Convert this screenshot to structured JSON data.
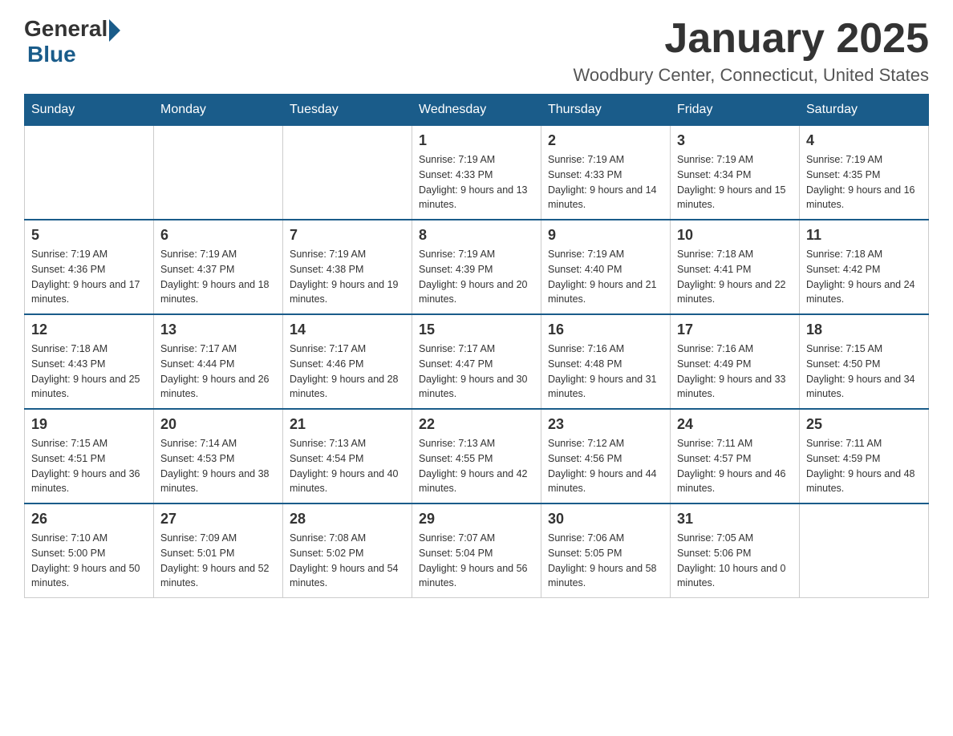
{
  "header": {
    "logo_general": "General",
    "logo_blue": "Blue",
    "title": "January 2025",
    "subtitle": "Woodbury Center, Connecticut, United States"
  },
  "days_of_week": [
    "Sunday",
    "Monday",
    "Tuesday",
    "Wednesday",
    "Thursday",
    "Friday",
    "Saturday"
  ],
  "weeks": [
    [
      {
        "day": "",
        "info": ""
      },
      {
        "day": "",
        "info": ""
      },
      {
        "day": "",
        "info": ""
      },
      {
        "day": "1",
        "info": "Sunrise: 7:19 AM\nSunset: 4:33 PM\nDaylight: 9 hours and 13 minutes."
      },
      {
        "day": "2",
        "info": "Sunrise: 7:19 AM\nSunset: 4:33 PM\nDaylight: 9 hours and 14 minutes."
      },
      {
        "day": "3",
        "info": "Sunrise: 7:19 AM\nSunset: 4:34 PM\nDaylight: 9 hours and 15 minutes."
      },
      {
        "day": "4",
        "info": "Sunrise: 7:19 AM\nSunset: 4:35 PM\nDaylight: 9 hours and 16 minutes."
      }
    ],
    [
      {
        "day": "5",
        "info": "Sunrise: 7:19 AM\nSunset: 4:36 PM\nDaylight: 9 hours and 17 minutes."
      },
      {
        "day": "6",
        "info": "Sunrise: 7:19 AM\nSunset: 4:37 PM\nDaylight: 9 hours and 18 minutes."
      },
      {
        "day": "7",
        "info": "Sunrise: 7:19 AM\nSunset: 4:38 PM\nDaylight: 9 hours and 19 minutes."
      },
      {
        "day": "8",
        "info": "Sunrise: 7:19 AM\nSunset: 4:39 PM\nDaylight: 9 hours and 20 minutes."
      },
      {
        "day": "9",
        "info": "Sunrise: 7:19 AM\nSunset: 4:40 PM\nDaylight: 9 hours and 21 minutes."
      },
      {
        "day": "10",
        "info": "Sunrise: 7:18 AM\nSunset: 4:41 PM\nDaylight: 9 hours and 22 minutes."
      },
      {
        "day": "11",
        "info": "Sunrise: 7:18 AM\nSunset: 4:42 PM\nDaylight: 9 hours and 24 minutes."
      }
    ],
    [
      {
        "day": "12",
        "info": "Sunrise: 7:18 AM\nSunset: 4:43 PM\nDaylight: 9 hours and 25 minutes."
      },
      {
        "day": "13",
        "info": "Sunrise: 7:17 AM\nSunset: 4:44 PM\nDaylight: 9 hours and 26 minutes."
      },
      {
        "day": "14",
        "info": "Sunrise: 7:17 AM\nSunset: 4:46 PM\nDaylight: 9 hours and 28 minutes."
      },
      {
        "day": "15",
        "info": "Sunrise: 7:17 AM\nSunset: 4:47 PM\nDaylight: 9 hours and 30 minutes."
      },
      {
        "day": "16",
        "info": "Sunrise: 7:16 AM\nSunset: 4:48 PM\nDaylight: 9 hours and 31 minutes."
      },
      {
        "day": "17",
        "info": "Sunrise: 7:16 AM\nSunset: 4:49 PM\nDaylight: 9 hours and 33 minutes."
      },
      {
        "day": "18",
        "info": "Sunrise: 7:15 AM\nSunset: 4:50 PM\nDaylight: 9 hours and 34 minutes."
      }
    ],
    [
      {
        "day": "19",
        "info": "Sunrise: 7:15 AM\nSunset: 4:51 PM\nDaylight: 9 hours and 36 minutes."
      },
      {
        "day": "20",
        "info": "Sunrise: 7:14 AM\nSunset: 4:53 PM\nDaylight: 9 hours and 38 minutes."
      },
      {
        "day": "21",
        "info": "Sunrise: 7:13 AM\nSunset: 4:54 PM\nDaylight: 9 hours and 40 minutes."
      },
      {
        "day": "22",
        "info": "Sunrise: 7:13 AM\nSunset: 4:55 PM\nDaylight: 9 hours and 42 minutes."
      },
      {
        "day": "23",
        "info": "Sunrise: 7:12 AM\nSunset: 4:56 PM\nDaylight: 9 hours and 44 minutes."
      },
      {
        "day": "24",
        "info": "Sunrise: 7:11 AM\nSunset: 4:57 PM\nDaylight: 9 hours and 46 minutes."
      },
      {
        "day": "25",
        "info": "Sunrise: 7:11 AM\nSunset: 4:59 PM\nDaylight: 9 hours and 48 minutes."
      }
    ],
    [
      {
        "day": "26",
        "info": "Sunrise: 7:10 AM\nSunset: 5:00 PM\nDaylight: 9 hours and 50 minutes."
      },
      {
        "day": "27",
        "info": "Sunrise: 7:09 AM\nSunset: 5:01 PM\nDaylight: 9 hours and 52 minutes."
      },
      {
        "day": "28",
        "info": "Sunrise: 7:08 AM\nSunset: 5:02 PM\nDaylight: 9 hours and 54 minutes."
      },
      {
        "day": "29",
        "info": "Sunrise: 7:07 AM\nSunset: 5:04 PM\nDaylight: 9 hours and 56 minutes."
      },
      {
        "day": "30",
        "info": "Sunrise: 7:06 AM\nSunset: 5:05 PM\nDaylight: 9 hours and 58 minutes."
      },
      {
        "day": "31",
        "info": "Sunrise: 7:05 AM\nSunset: 5:06 PM\nDaylight: 10 hours and 0 minutes."
      },
      {
        "day": "",
        "info": ""
      }
    ]
  ]
}
